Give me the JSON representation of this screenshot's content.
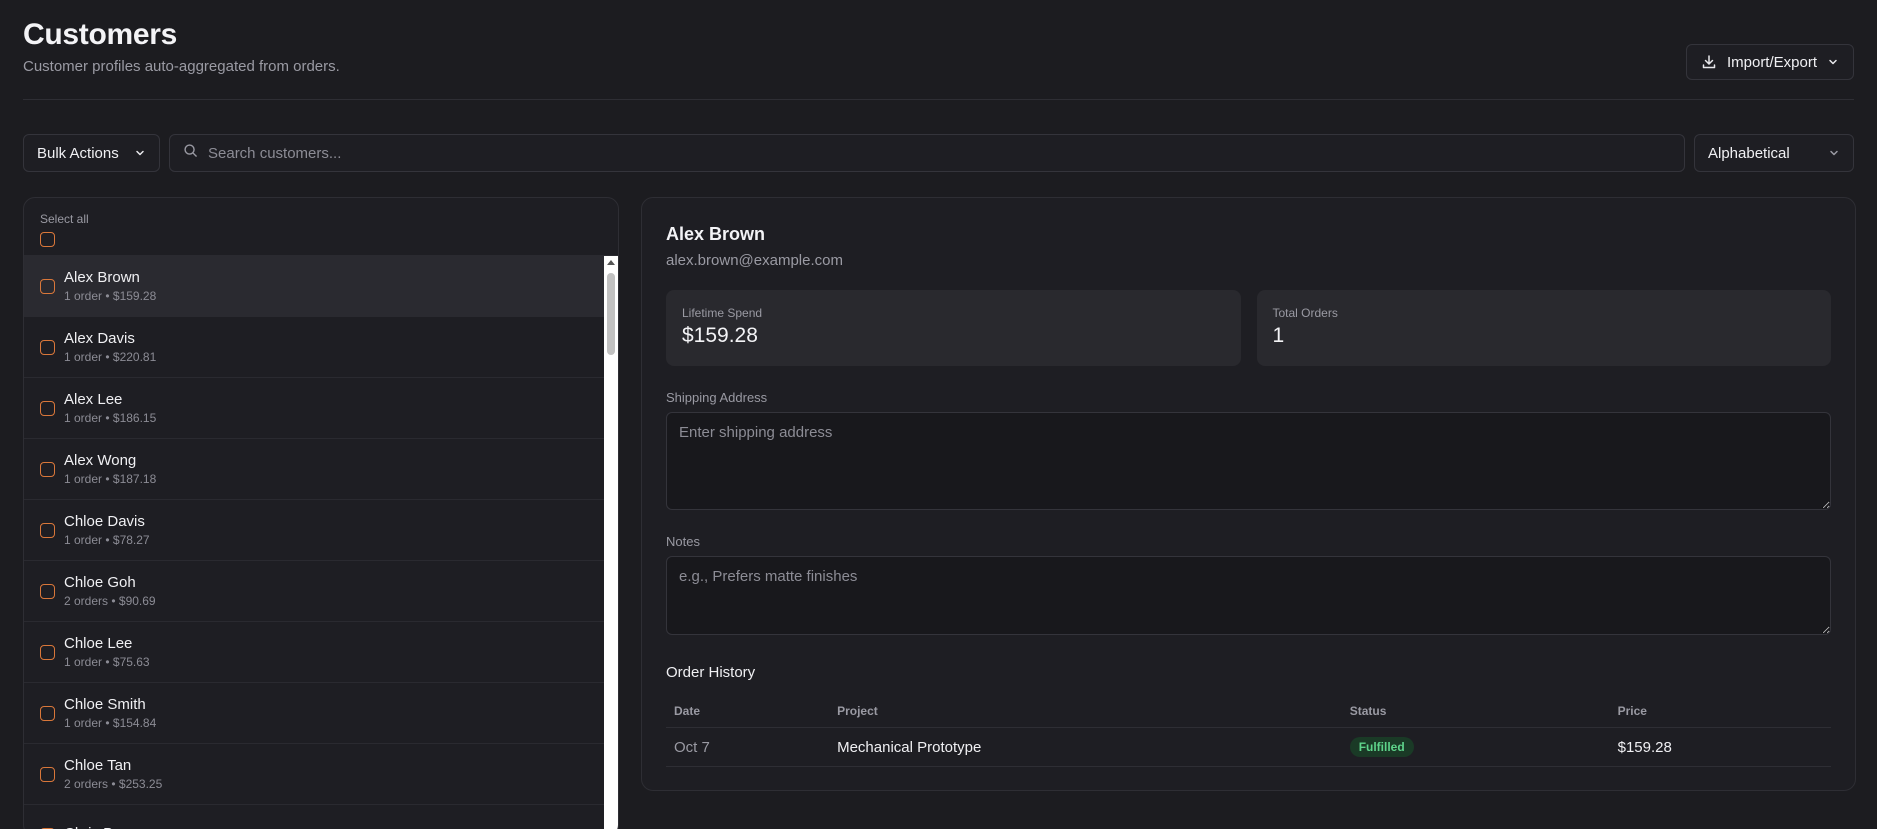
{
  "header": {
    "title": "Customers",
    "subtitle": "Customer profiles auto-aggregated from orders.",
    "import_export_label": "Import/Export"
  },
  "toolbar": {
    "bulk_actions_label": "Bulk Actions",
    "search_placeholder": "Search customers...",
    "sort_value": "Alphabetical"
  },
  "list": {
    "select_all_label": "Select all",
    "customers": [
      {
        "name": "Alex Brown",
        "meta": "1 order • $159.28",
        "active": true
      },
      {
        "name": "Alex Davis",
        "meta": "1 order • $220.81"
      },
      {
        "name": "Alex Lee",
        "meta": "1 order • $186.15"
      },
      {
        "name": "Alex Wong",
        "meta": "1 order • $187.18"
      },
      {
        "name": "Chloe Davis",
        "meta": "1 order • $78.27"
      },
      {
        "name": "Chloe Goh",
        "meta": "2 orders • $90.69"
      },
      {
        "name": "Chloe Lee",
        "meta": "1 order • $75.63"
      },
      {
        "name": "Chloe Smith",
        "meta": "1 order • $154.84"
      },
      {
        "name": "Chloe Tan",
        "meta": "2 orders • $253.25"
      },
      {
        "name": "Chris Brown",
        "meta": ""
      }
    ]
  },
  "detail": {
    "name": "Alex Brown",
    "email": "alex.brown@example.com",
    "lifetime_spend_label": "Lifetime Spend",
    "lifetime_spend_value": "$159.28",
    "total_orders_label": "Total Orders",
    "total_orders_value": "1",
    "shipping_label": "Shipping Address",
    "shipping_placeholder": "Enter shipping address",
    "notes_label": "Notes",
    "notes_placeholder": "e.g., Prefers matte finishes",
    "history_title": "Order History",
    "history_columns": [
      "Date",
      "Project",
      "Status",
      "Price"
    ],
    "orders": [
      {
        "date": "Oct 7",
        "project": "Mechanical Prototype",
        "status": "Fulfilled",
        "price": "$159.28"
      }
    ]
  },
  "colors": {
    "accent": "#d9773a",
    "status_fulfilled": "#5ed38a",
    "background": "#1c1c20"
  }
}
